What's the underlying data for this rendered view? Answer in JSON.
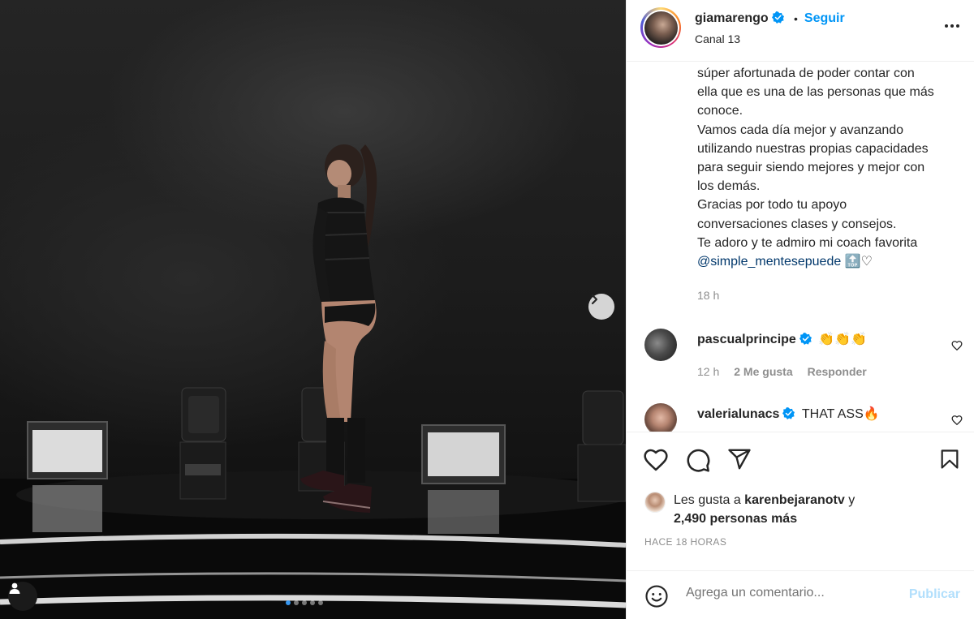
{
  "media": {
    "next_arrow_icon": "chevron-right-icon",
    "user_tag_icon": "person-icon",
    "carousel": {
      "total": 5,
      "active": 1
    }
  },
  "header": {
    "username": "giamarengo",
    "separator": "•",
    "follow_label": "Seguir",
    "location": "Canal 13"
  },
  "caption": {
    "lines_before_mention": "súper afortunada de poder contar con\nella que es una de las personas que más\nconoce.\nVamos cada día mejor y avanzando\nutilizando nuestras propias capacidades\npara seguir siendo mejores y mejor con\nlos demás.\nGracias por todo tu apoyo\nconversaciones clases y consejos.\nTe adoro y te admiro mi coach favorita\n",
    "mention": "@simple_mentesepuede",
    "emoji_after": " 🔝♡",
    "time": "18 h"
  },
  "comments": [
    {
      "username": "pascualprincipe",
      "text": "👏👏👏",
      "time": "12 h",
      "likes": "2 Me gusta",
      "reply_label": "Responder"
    },
    {
      "username": "valerialunacs",
      "text": "THAT ASS🔥"
    }
  ],
  "likes": {
    "prefix": "Les gusta a ",
    "liked_by": "karenbejaranotv",
    "connector": " y",
    "others": "2,490 personas más"
  },
  "timestamp": "HACE 18 HORAS",
  "comment_box": {
    "placeholder": "Agrega un comentario...",
    "publish_label": "Publicar"
  },
  "colors": {
    "accent": "#0095f6",
    "mention": "#00376b",
    "muted": "#8e8e8e",
    "publish_disabled": "#b2dffc",
    "carousel_active": "#3797f0"
  }
}
